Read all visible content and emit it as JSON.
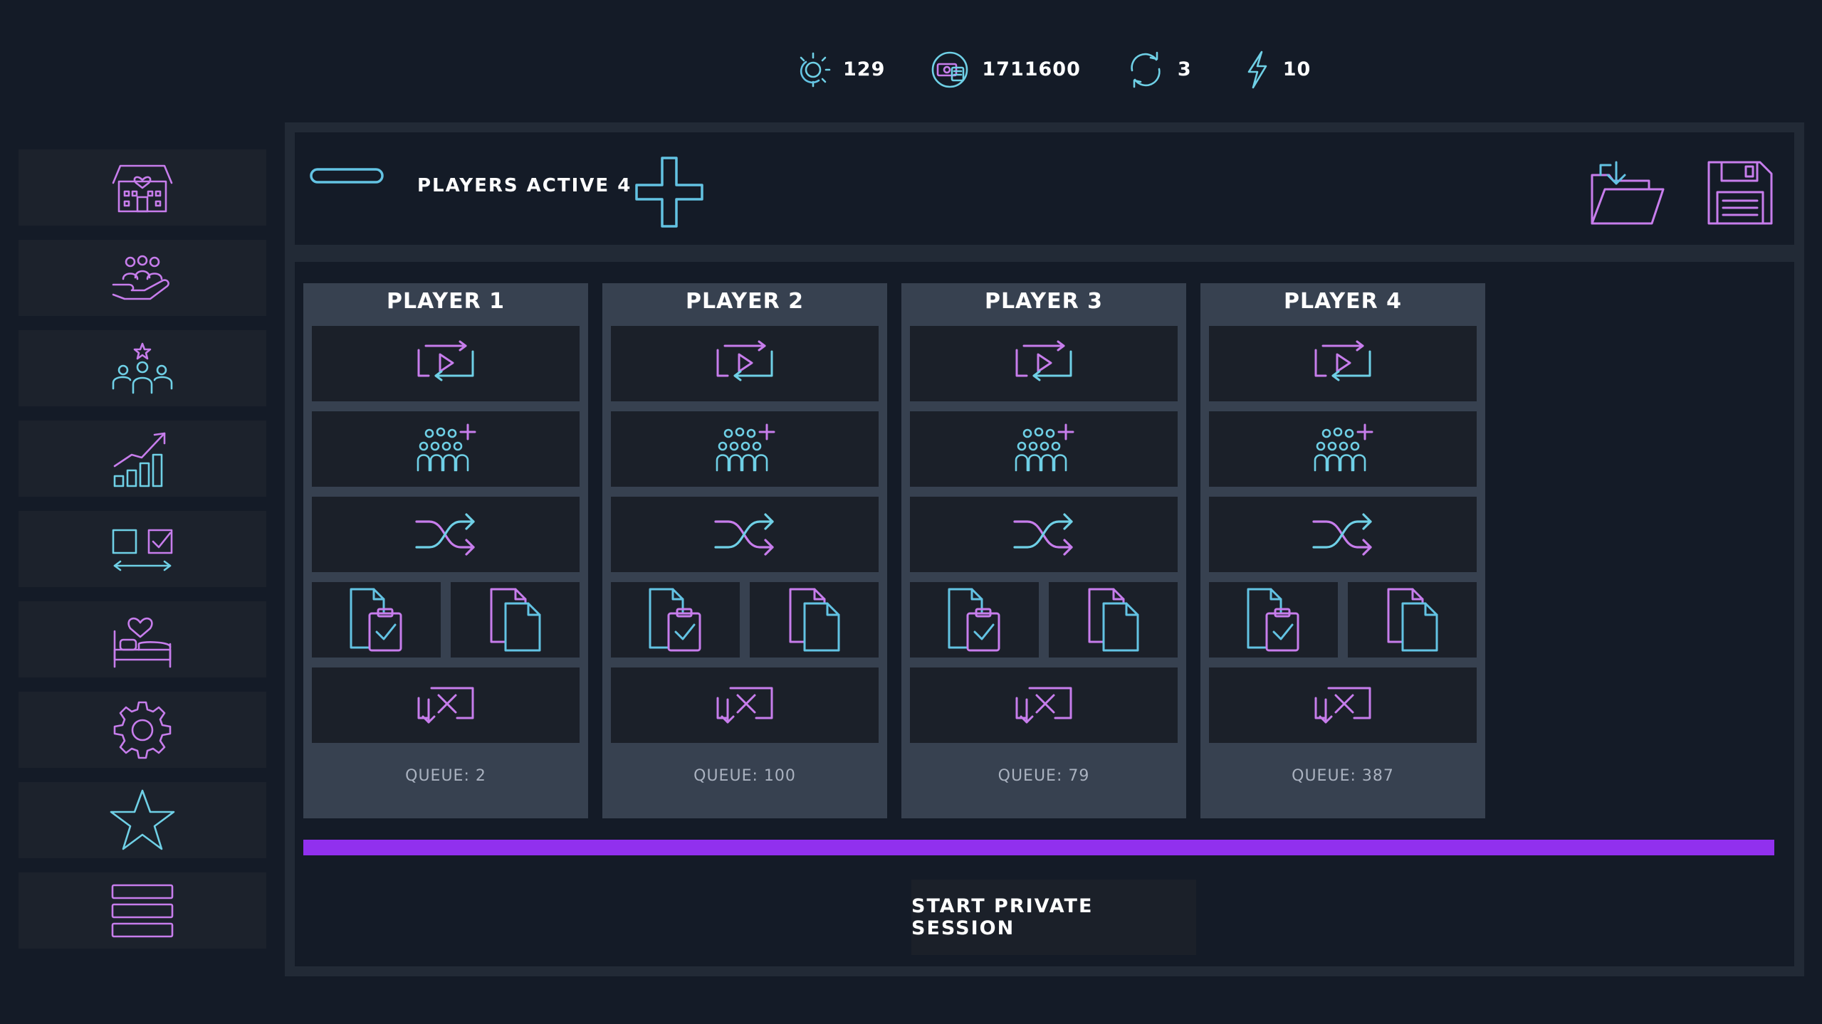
{
  "stats": [
    {
      "icon": "sun-moon-icon",
      "value": "129"
    },
    {
      "icon": "money-icon",
      "value": "1711600"
    },
    {
      "icon": "refresh-icon",
      "value": "3"
    },
    {
      "icon": "lightning-icon",
      "value": "10"
    }
  ],
  "sidebar": {
    "items": [
      {
        "icon": "hotel-heart-icon"
      },
      {
        "icon": "people-hand-icon"
      },
      {
        "icon": "team-star-icon"
      },
      {
        "icon": "growth-chart-icon"
      },
      {
        "icon": "checkbox-compare-icon"
      },
      {
        "icon": "bed-heart-icon"
      },
      {
        "icon": "gear-icon"
      },
      {
        "icon": "star-icon"
      },
      {
        "icon": "menu-stack-icon"
      }
    ]
  },
  "toolbar": {
    "players_active_label": "PLAYERS ACTIVE 4",
    "minus_icon": "minus-icon",
    "plus_icon": "plus-icon",
    "load_icon": "folder-download-icon",
    "save_icon": "floppy-save-icon"
  },
  "players": [
    {
      "title": "PLAYER 1",
      "queue": "QUEUE: 2"
    },
    {
      "title": "PLAYER 2",
      "queue": "QUEUE: 100"
    },
    {
      "title": "PLAYER 3",
      "queue": "QUEUE: 79"
    },
    {
      "title": "PLAYER 4",
      "queue": "QUEUE: 387"
    }
  ],
  "player_actions": [
    "replay-video-icon",
    "add-group-icon",
    "shuffle-icon",
    "clipboard-check-icon",
    "copy-document-icon",
    "clear-x-icon"
  ],
  "start_button": {
    "label": "START PRIVATE SESSION"
  },
  "progress": {
    "fraction": 1.0
  },
  "colors": {
    "background": "#141b27",
    "panel": "#222a36",
    "column": "#374150",
    "button": "#1b2029",
    "accent_pink": "#c77dec",
    "accent_cyan": "#6fd0e6",
    "progress": "#9130ee"
  }
}
